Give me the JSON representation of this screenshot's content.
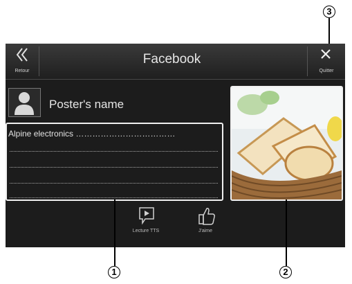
{
  "header": {
    "back_label": "Retour",
    "title": "Facebook",
    "quit_label": "Quitter"
  },
  "post": {
    "poster_name": "Poster's name",
    "text_first_line": "Alpine electronics ………………………………"
  },
  "actions": {
    "tts_label": "Lecture TTS",
    "like_label": "J'aime"
  },
  "callouts": {
    "c1": "1",
    "c2": "2",
    "c3": "3"
  },
  "icons": [
    "back-chevron-icon",
    "close-icon",
    "person-icon",
    "play-speech-icon",
    "thumbs-up-icon"
  ]
}
